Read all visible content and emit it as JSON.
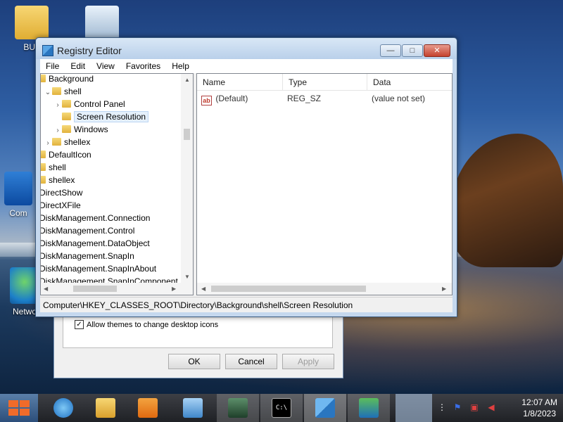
{
  "desktop": {
    "icons": [
      {
        "label": "BUL"
      },
      {
        "label": ""
      },
      {
        "label": "Com"
      },
      {
        "label": "Network"
      }
    ]
  },
  "background_dialog": {
    "checkbox_label": "Allow themes to change desktop icons",
    "checkbox_checked": true,
    "ok_label": "OK",
    "cancel_label": "Cancel",
    "apply_label": "Apply"
  },
  "window": {
    "title": "Registry Editor",
    "controls": {
      "minimize": "—",
      "maximize": "□",
      "close": "✕"
    },
    "menu": [
      "File",
      "Edit",
      "View",
      "Favorites",
      "Help"
    ],
    "tree": [
      {
        "label": "Background",
        "toggle": "",
        "depth": 0
      },
      {
        "label": "shell",
        "toggle": "⌄",
        "depth": 1
      },
      {
        "label": "Control Panel",
        "toggle": "›",
        "depth": 2
      },
      {
        "label": "Screen Resolution",
        "toggle": "",
        "depth": 2,
        "selected": true
      },
      {
        "label": "Windows",
        "toggle": "›",
        "depth": 2
      },
      {
        "label": "shellex",
        "toggle": "›",
        "depth": 1
      },
      {
        "label": "DefaultIcon",
        "toggle": "",
        "depth": 0
      },
      {
        "label": "shell",
        "toggle": "",
        "depth": 0
      },
      {
        "label": "shellex",
        "toggle": "",
        "depth": 0
      },
      {
        "label": "DirectShow",
        "toggle": "",
        "depth": -1
      },
      {
        "label": "DirectXFile",
        "toggle": "",
        "depth": -1
      },
      {
        "label": "DiskManagement.Connection",
        "toggle": "",
        "depth": -1
      },
      {
        "label": "DiskManagement.Control",
        "toggle": "",
        "depth": -1
      },
      {
        "label": "DiskManagement.DataObject",
        "toggle": "",
        "depth": -1
      },
      {
        "label": "DiskManagement.SnapIn",
        "toggle": "",
        "depth": -1
      },
      {
        "label": "DiskManagement.SnapInAbout",
        "toggle": "",
        "depth": -1
      },
      {
        "label": "DiskManagement.SnapInComponent",
        "toggle": "",
        "depth": -1
      }
    ],
    "columns": [
      "Name",
      "Type",
      "Data"
    ],
    "values": [
      {
        "icon": "ab",
        "name": "(Default)",
        "type": "REG_SZ",
        "data": "(value not set)"
      }
    ],
    "status_path": "Computer\\HKEY_CLASSES_ROOT\\Directory\\Background\\shell\\Screen Resolution"
  },
  "taskbar": {
    "items": [
      "internet-explorer-icon",
      "file-explorer-icon",
      "media-player-icon",
      "control-panel-icon",
      "task-manager-icon",
      "command-prompt-icon",
      "registry-editor-icon",
      "display-settings-icon"
    ],
    "active_item": "registry-editor-icon",
    "clock_time": "12:07 AM",
    "clock_date": "1/8/2023"
  },
  "colors": {
    "accent": "#2c4e7a",
    "close_button": "#c5422e",
    "selection": "#e5f0fb"
  }
}
